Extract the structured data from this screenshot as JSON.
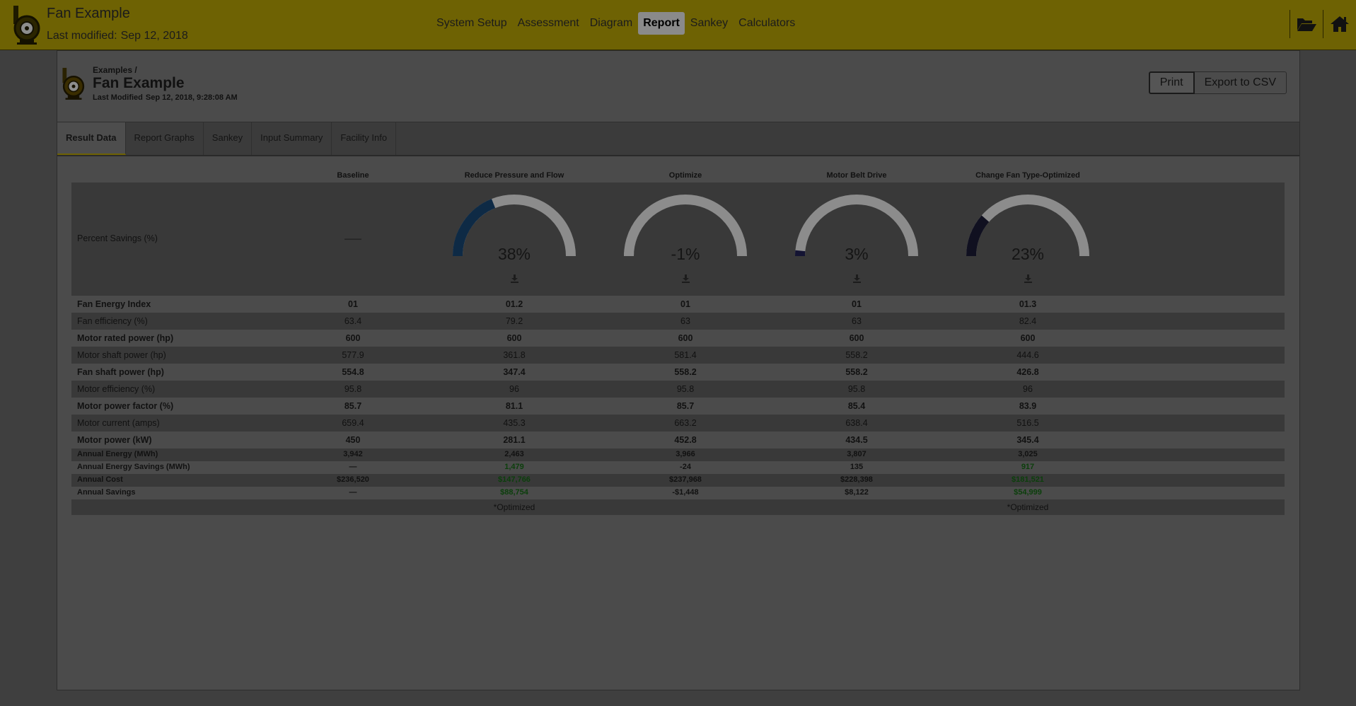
{
  "app": {
    "title": "Fan Example",
    "modified_label": "Last modified:",
    "modified_date": "Sep 12, 2018",
    "nav": [
      "System Setup",
      "Assessment",
      "Diagram",
      "Report",
      "Sankey",
      "Calculators"
    ],
    "active_nav": "Report",
    "icons": [
      "folder-open-icon",
      "home-icon"
    ],
    "brand_color": "#6e6203"
  },
  "card": {
    "breadcrumb": "Examples /",
    "name": "Fan Example",
    "modified_label": "Last Modified",
    "modified_date": "Sep 12, 2018, 9:28:08 AM",
    "print_label": "Print",
    "export_label": "Export to CSV"
  },
  "tabs": [
    "Result Data",
    "Report Graphs",
    "Sankey",
    "Input Summary",
    "Facility Info"
  ],
  "active_tab": "Result Data",
  "columns": [
    "Baseline",
    "Reduce Pressure and Flow",
    "Optimize",
    "Motor Belt Drive",
    "Change Fan Type-Optimized"
  ],
  "percent_savings": {
    "label": "Percent Savings (%)",
    "baseline": "——",
    "values": [
      38,
      -1,
      3,
      23
    ],
    "display": [
      "38%",
      "-1%",
      "3%",
      "23%"
    ],
    "colors": [
      "#0e2a45",
      "#1c1c33",
      "#141433",
      "#101020"
    ]
  },
  "rows": [
    {
      "label": "Fan Energy Index",
      "values": [
        "01",
        "01.2",
        "01",
        "01",
        "01.3"
      ],
      "bold": true
    },
    {
      "label": "Fan efficiency (%)",
      "values": [
        "63.4",
        "79.2",
        "63",
        "63",
        "82.4"
      ]
    },
    {
      "label": "Motor rated power (hp)",
      "values": [
        "600",
        "600",
        "600",
        "600",
        "600"
      ],
      "bold": true
    },
    {
      "label": "Motor shaft power (hp)",
      "values": [
        "577.9",
        "361.8",
        "581.4",
        "558.2",
        "444.6"
      ]
    },
    {
      "label": "Fan shaft power (hp)",
      "values": [
        "554.8",
        "347.4",
        "558.2",
        "558.2",
        "426.8"
      ],
      "bold": true
    },
    {
      "label": "Motor efficiency (%)",
      "values": [
        "95.8",
        "96",
        "95.8",
        "95.8",
        "96"
      ]
    },
    {
      "label": "Motor power factor (%)",
      "values": [
        "85.7",
        "81.1",
        "85.7",
        "85.4",
        "83.9"
      ],
      "bold": true
    },
    {
      "label": "Motor current (amps)",
      "values": [
        "659.4",
        "435.3",
        "663.2",
        "638.4",
        "516.5"
      ]
    },
    {
      "label": "Motor power (kW)",
      "values": [
        "450",
        "281.1",
        "452.8",
        "434.5",
        "345.4"
      ],
      "bold": true
    }
  ],
  "summary_rows": [
    {
      "label": "Annual Energy (MWh)",
      "values": [
        "3,942",
        "2,463",
        "3,966",
        "3,807",
        "3,025"
      ]
    },
    {
      "label": "Annual Energy Savings (MWh)",
      "values": [
        "—",
        "1,479",
        "-24",
        "135",
        "917"
      ],
      "green": [
        1,
        4
      ]
    },
    {
      "label": "Annual Cost",
      "values": [
        "$236,520",
        "$147,766",
        "$237,968",
        "$228,398",
        "$181,521"
      ],
      "green": [
        1,
        4
      ]
    },
    {
      "label": "Annual Savings",
      "values": [
        "—",
        "$88,754",
        "-$1,448",
        "$8,122",
        "$54,999"
      ],
      "green": [
        1,
        4
      ]
    }
  ],
  "optimized_notes": [
    "",
    "*Optimized",
    "",
    "",
    "*Optimized"
  ]
}
